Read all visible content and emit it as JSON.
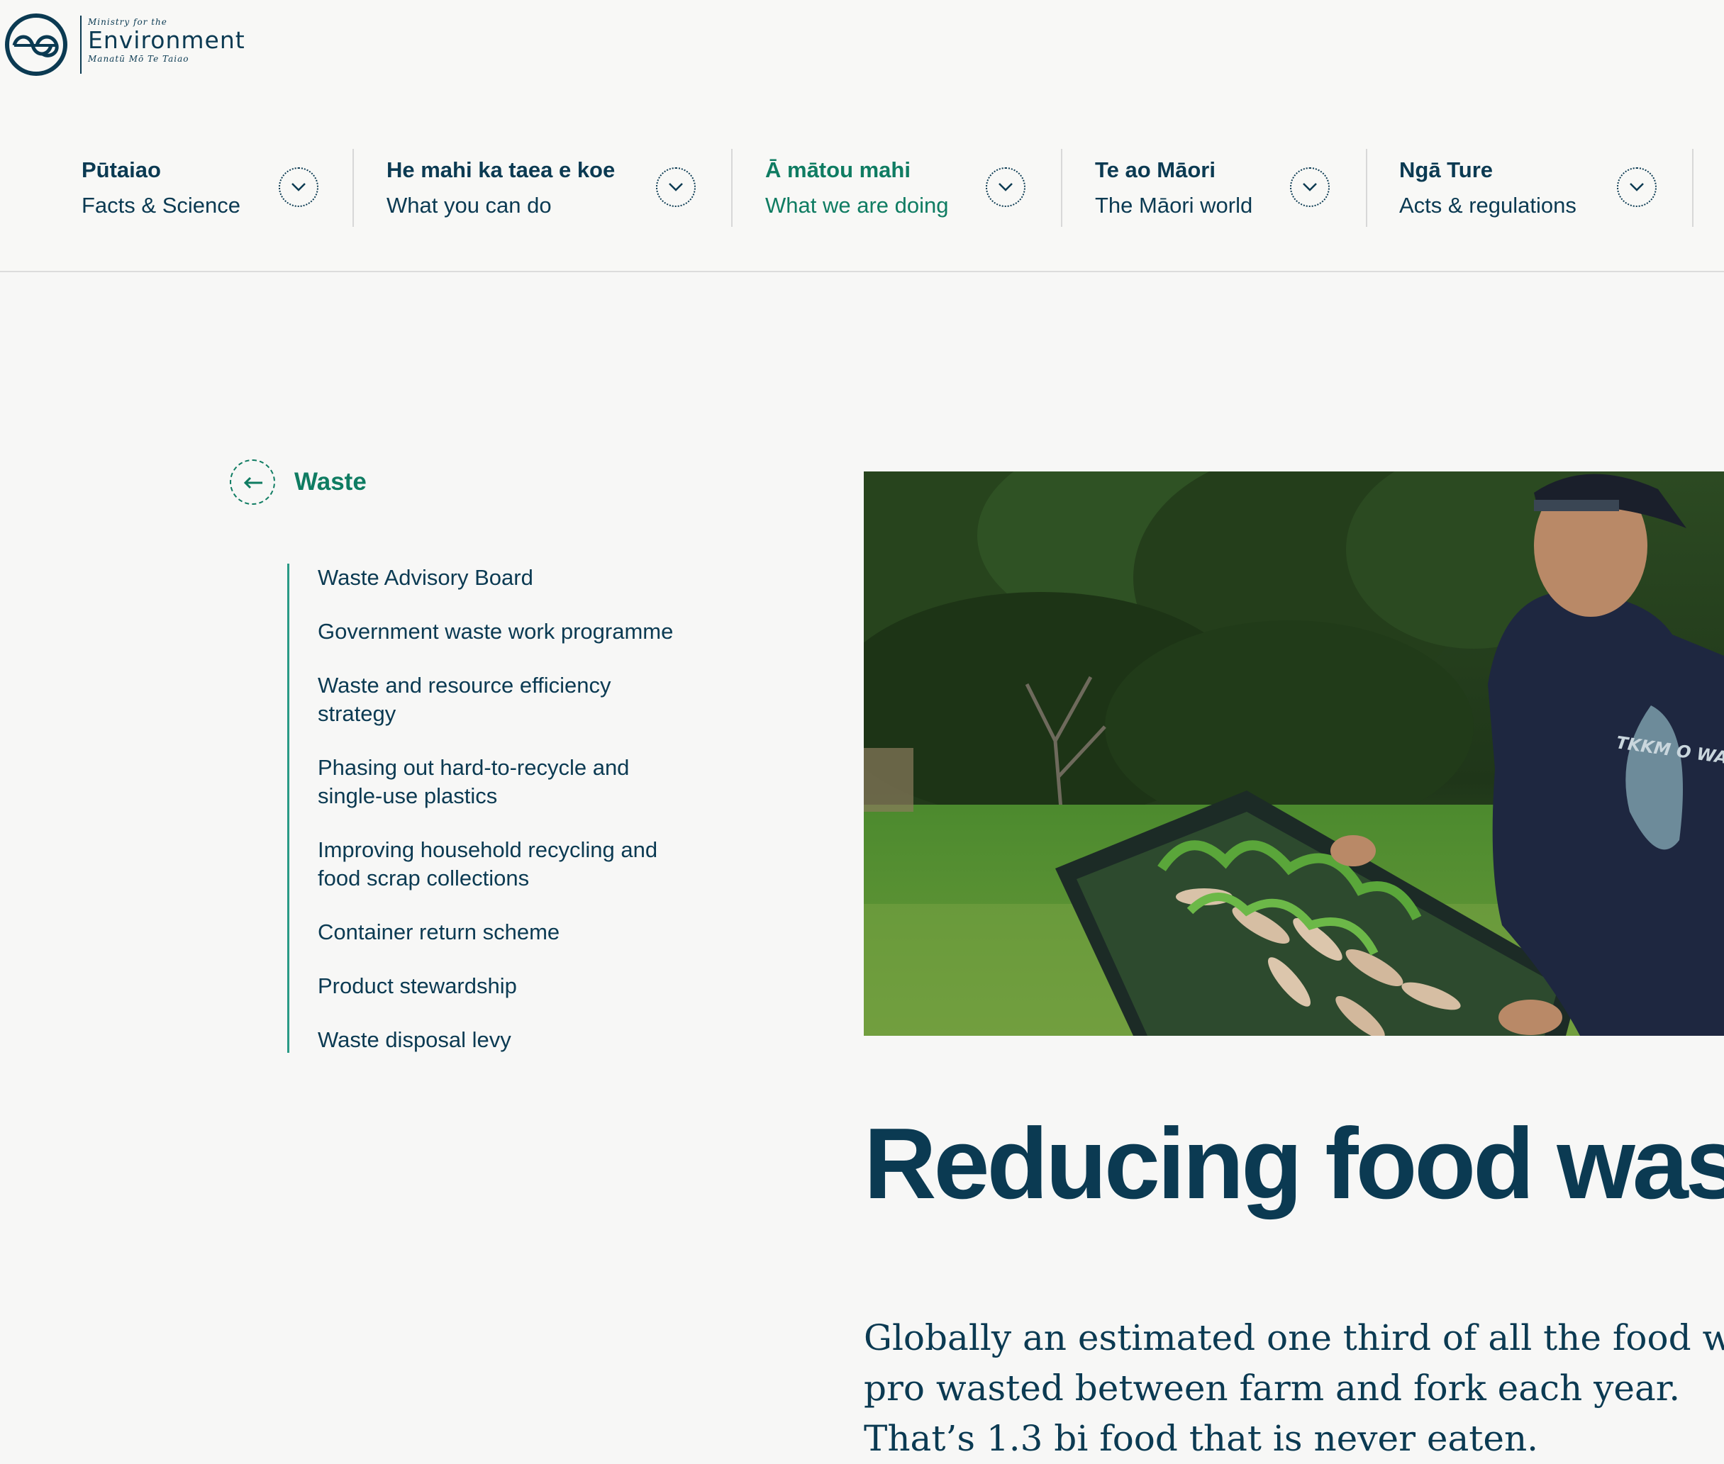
{
  "logo": {
    "small_top": "Ministry for the",
    "name": "Environment",
    "small_bottom": "Manatū Mō Te Taiao"
  },
  "nav": [
    {
      "title": "Pūtaiao",
      "subtitle": "Facts & Science"
    },
    {
      "title": "He mahi ka taea e koe",
      "subtitle": "What you can do"
    },
    {
      "title": "Ā mātou mahi",
      "subtitle": "What we are doing",
      "active": true
    },
    {
      "title": "Te ao Māori",
      "subtitle": "The Māori world"
    },
    {
      "title": "Ngā Ture",
      "subtitle": "Acts & regulations"
    }
  ],
  "sidebar": {
    "title": "Waste",
    "items": [
      "Waste Advisory Board",
      "Government waste work programme",
      "Waste and resource efficiency strategy",
      "Phasing out hard-to-recycle and single-use plastics",
      "Improving household recycling and food scrap collections",
      "Container return scheme",
      "Product stewardship",
      "Waste disposal levy"
    ]
  },
  "main": {
    "headline": "Reducing food was",
    "intro": "Globally an estimated one third of all the food we pro wasted between farm and fork each year. That’s 1.3 bi food that is never eaten.",
    "hoodie_text": "TKKM O WAWA KAWA TAI TAWHITI"
  },
  "colors": {
    "navy": "#0b3a52",
    "green": "#0f7c62"
  }
}
